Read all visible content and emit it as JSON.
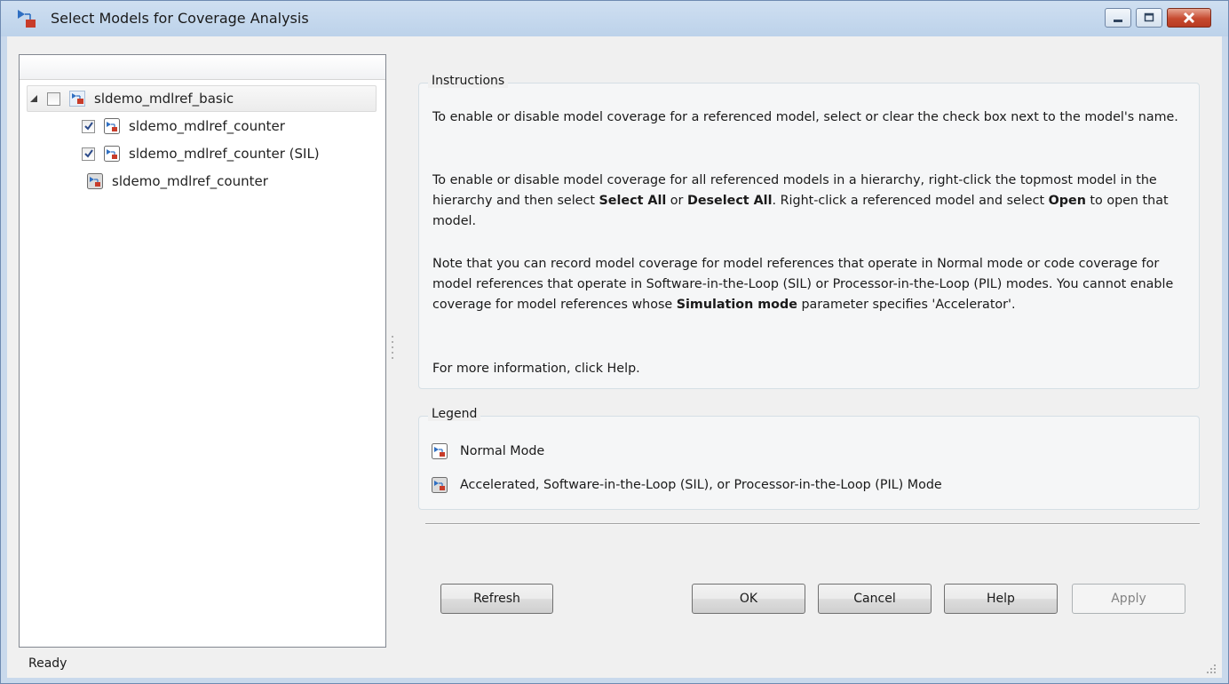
{
  "window": {
    "title": "Select Models for Coverage Analysis"
  },
  "tree": {
    "items": [
      {
        "label": "sldemo_mdlref_basic",
        "checked": false,
        "level": 0,
        "icon": "model-icon",
        "expanded": true
      },
      {
        "label": "sldemo_mdlref_counter",
        "checked": true,
        "level": 1,
        "icon": "normal-mode-icon"
      },
      {
        "label": "sldemo_mdlref_counter (SIL)",
        "checked": true,
        "level": 1,
        "icon": "normal-mode-icon"
      },
      {
        "label": "sldemo_mdlref_counter",
        "checked": null,
        "level": 1,
        "icon": "accelerated-mode-icon"
      }
    ]
  },
  "instructions": {
    "title": "Instructions",
    "p1": "To enable or disable model coverage for a referenced model, select or clear the check box next to the model's name.",
    "p2_a": "To enable or disable model coverage for all referenced models in a hierarchy, right-click the topmost model in the hierarchy and then select ",
    "p2_b": "Select All",
    "p2_c": " or ",
    "p2_d": "Deselect All",
    "p2_e": ". Right-click a referenced model and select ",
    "p2_f": "Open",
    "p2_g": " to open that model.",
    "p3_a": "Note that you can record model coverage for model references that operate in Normal mode or code coverage for model references that operate in Software-in-the-Loop (SIL) or Processor-in-the-Loop (PIL) modes. You cannot enable coverage for model references whose ",
    "p3_b": "Simulation mode",
    "p3_c": " parameter specifies 'Accelerator'.",
    "p4": "For more information, click Help."
  },
  "legend": {
    "title": "Legend",
    "normal": "Normal Mode",
    "accelerated": "Accelerated, Software-in-the-Loop (SIL), or Processor-in-the-Loop (PIL) Mode"
  },
  "buttons": {
    "refresh": "Refresh",
    "ok": "OK",
    "cancel": "Cancel",
    "help": "Help",
    "apply": "Apply"
  },
  "status": {
    "text": "Ready"
  },
  "colors": {
    "titlebar": "#c9d9ec",
    "close_button": "#c64a2f",
    "model_icon_blue": "#2f6fc2",
    "model_icon_red": "#c83c2a"
  }
}
